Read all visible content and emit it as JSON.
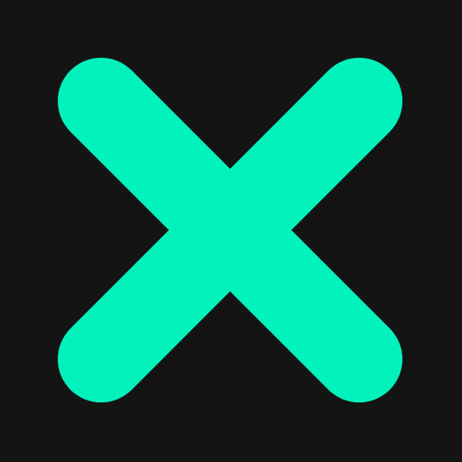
{
  "icon": {
    "name": "close-icon",
    "glyph": "x-mark"
  },
  "colors": {
    "background": "#141414",
    "accent": "#03F2BC"
  }
}
